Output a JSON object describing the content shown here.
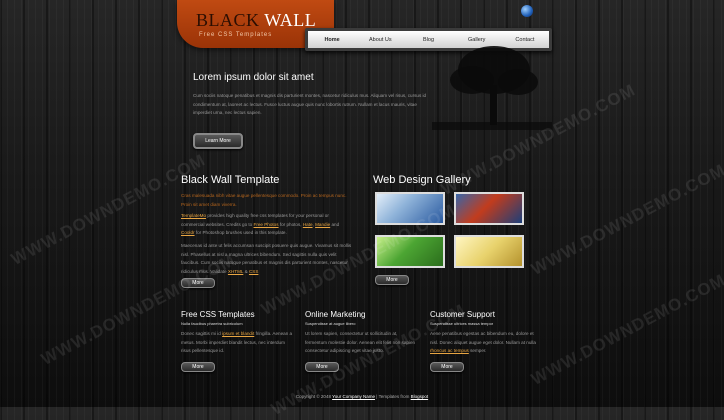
{
  "logo": {
    "title_black": "BLACK",
    "title_wall": "WALL",
    "subtitle": "Free CSS Templates"
  },
  "nav": {
    "items": [
      "Home",
      "About Us",
      "Blog",
      "Gallery",
      "Contact"
    ]
  },
  "hero": {
    "title": "Lorem ipsum dolor sit amet",
    "text": "Cum sociis natoque penatibus et magnis dis parturient montes, nascetur ridiculus mus. Aliquam vel risus, cursus id condimentum at, laoreet ac lectus. Fusce luctus augue quis nunc lobortis rutrum. Nullam et lacus mauris, vitae imperdiet urna, nec lectus sapien.",
    "button": "Learn More"
  },
  "black_wall": {
    "title": "Black Wall Template",
    "p1": "Cras malesuada nibh vitae augue pellentesque commodo. Proin ac tempus nunc. Proin sit amet diam viverra.",
    "p2_start": "provides high quality free css templates for your personal or commercial websites. Credits go to",
    "p2_link1": "TemplateMo",
    "p2_link2": "Free Photos",
    "p2_mid": "for photos,",
    "p2_link3": "Hate",
    "p2_link4": "Mandie",
    "p2_and": "and",
    "p2_link5": "Cooldr",
    "p2_end": "for Photoshop brushes used in this template.",
    "p3": "Maecenas id ante ut felis accumsan suscipit posuere quis augue. Vivamus sit mollis nisl. Phasellus at nisl a magna ultrices bibendum. Sed sagittis nulla quis velit faucibus. Cum sociis natoque penatibus et magnis dis parturient montes, nascetur ridiculus mus. Validate",
    "p3_link1": "XHTML",
    "p3_amp": "&",
    "p3_link2": "CSS",
    "button": "More"
  },
  "gallery": {
    "title": "Web Design Gallery",
    "button": "More"
  },
  "columns": [
    {
      "title": "Free CSS Templates",
      "subtitle": "Nulla faucibus pharetra subricolum",
      "text_a": "Donec sagittis mi id",
      "link": "ipsum et blandit",
      "text_b": "fringilla. Aenean a metus. Morbi imperdiet blandit lectus, nec interdum risus pellentesque id.",
      "button": "More"
    },
    {
      "title": "Online Marketing",
      "subtitle": "Suspendisse at augue libero",
      "text_a": "Ut lorem sapien, consectetur ut sollicitudin at, fermentum molestie dolor. Aenean elit felis non sapien consectetur adipiscing eget vitae justo.",
      "button": "More"
    },
    {
      "title": "Customer Support",
      "subtitle": "Suspendisse ultrices massa tempor",
      "text_a": "Aene penatibus egestas ac bibendum eu, dolore et nisl. Donec aliquet augue eget dolor. Nullam at nulla",
      "link": "rhoncus ac tempus",
      "text_b": "semper.",
      "button": "More"
    }
  ],
  "footer": {
    "text": "Copyright © 2048",
    "link1": "Your Company Name",
    "sep": "| Templates from",
    "link2": "Blogspot"
  },
  "watermark": "WWW.DOWNDEMO.COM"
}
